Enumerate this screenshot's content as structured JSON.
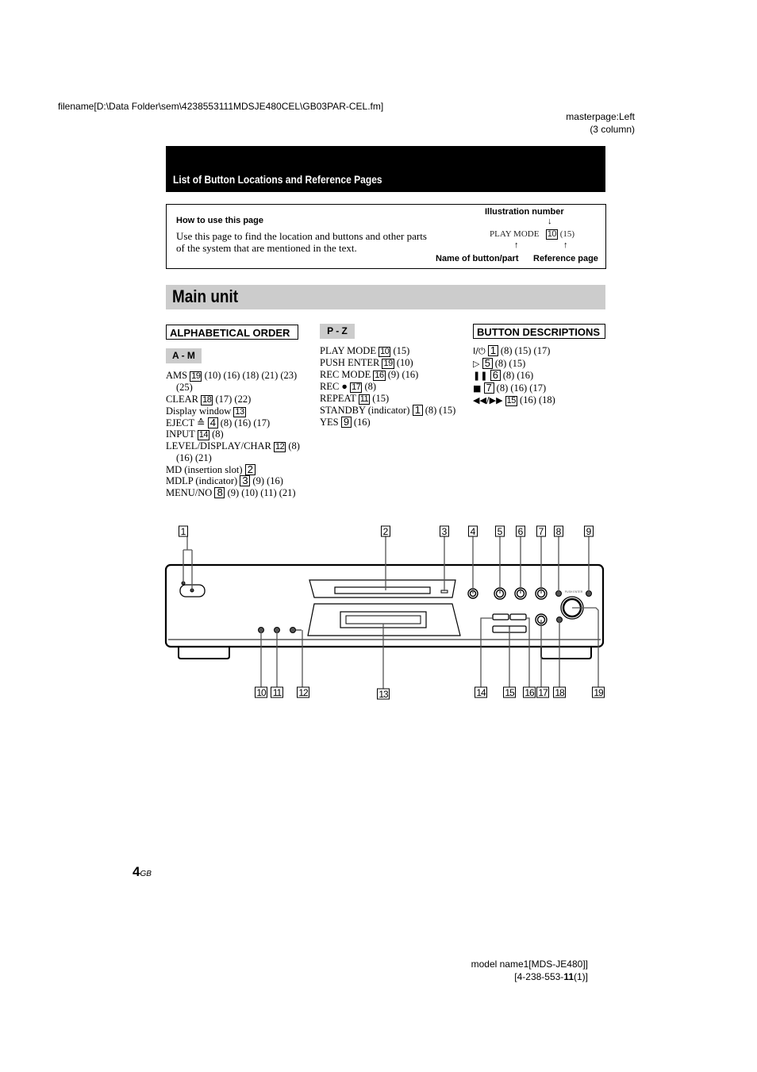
{
  "meta": {
    "filename": "filename[D:\\Data Folder\\sem\\4238553111MDSJE480CEL\\GB03PAR-CEL.fm]",
    "masterpage_line1": "masterpage:Left",
    "masterpage_line2": "(3 column)"
  },
  "header": {
    "title": "List of Button Locations and Reference Pages"
  },
  "howto": {
    "heading": "How to use this page",
    "body": "Use this page to find the location and buttons and other parts of the system that are mentioned in the text.",
    "legend": {
      "illustration_number": "Illustration number",
      "example_name": "PLAY MODE",
      "example_number": "10",
      "example_ref": "(15)",
      "name_label": "Name of button/part",
      "ref_label": "Reference page",
      "arrow_down": "↓",
      "arrow_up": "↑"
    }
  },
  "section": {
    "title": "Main unit"
  },
  "alphabetical": {
    "heading": "ALPHABETICAL ORDER",
    "am": {
      "label": "A - M",
      "entries": [
        {
          "name": "AMS",
          "num": "19",
          "refs": "(10) (16) (18) (21) (23)",
          "refs2": "(25)"
        },
        {
          "name": "CLEAR",
          "num": "18",
          "refs": "(17) (22)"
        },
        {
          "name": "Display window",
          "num": "13",
          "refs": ""
        },
        {
          "name": "EJECT ≙",
          "num": "4",
          "refs": "(8) (16) (17)"
        },
        {
          "name": "INPUT",
          "num": "14",
          "refs": "(8)"
        },
        {
          "name": "LEVEL/DISPLAY/CHAR",
          "num": "12",
          "refs": "(8)",
          "refs2": "(16) (21)"
        },
        {
          "name": "MD (insertion slot)",
          "num": "2",
          "refs": ""
        },
        {
          "name": "MDLP (indicator)",
          "num": "3",
          "refs": "(9) (16)"
        },
        {
          "name": "MENU/NO",
          "num": "8",
          "refs": "(9) (10) (11) (21)"
        }
      ]
    },
    "pz": {
      "label": "P - Z",
      "entries": [
        {
          "name": "PLAY MODE",
          "num": "10",
          "refs": "(15)"
        },
        {
          "name": "PUSH ENTER",
          "num": "19",
          "refs": "(10)"
        },
        {
          "name": "REC MODE",
          "num": "16",
          "refs": "(9) (16)"
        },
        {
          "name": "REC ●",
          "num": "17",
          "refs": "(8)"
        },
        {
          "name": "REPEAT",
          "num": "11",
          "refs": "(15)"
        },
        {
          "name": "STANDBY (indicator)",
          "num": "1",
          "refs": "(8) (15)"
        },
        {
          "name": "YES",
          "num": "9",
          "refs": "(16)"
        }
      ]
    }
  },
  "descriptions": {
    "heading": "BUTTON DESCRIPTIONS",
    "entries": [
      {
        "symbol": "I/⏻",
        "icon": "power-icon",
        "num": "1",
        "refs": "(8) (15) (17)"
      },
      {
        "symbol": "▷",
        "icon": "play-icon",
        "num": "5",
        "refs": "(8) (15)"
      },
      {
        "symbol": "❚❚",
        "icon": "pause-icon",
        "num": "6",
        "refs": "(8) (16)"
      },
      {
        "symbol": "■",
        "icon": "stop-icon",
        "num": "7",
        "refs": "(8) (16) (17)"
      },
      {
        "symbol": "◀◀/▶▶",
        "icon": "rewind-forward-icon",
        "num": "15",
        "refs": "(16) (18)"
      }
    ]
  },
  "illustration": {
    "top_labels": [
      "1",
      "2",
      "3",
      "4",
      "5",
      "6",
      "7",
      "8",
      "9"
    ],
    "bottom_labels": [
      "10",
      "11",
      "12",
      "13",
      "14",
      "15",
      "16",
      "17",
      "18",
      "19"
    ],
    "knob_caption": "PUSH ENTER"
  },
  "page": {
    "number": "4",
    "suffix": "GB"
  },
  "footer": {
    "model_line": "model name1[MDS-JE480]]",
    "code_prefix": "[4-238-553-",
    "code_bold": "11",
    "code_suffix": "(1)]"
  }
}
